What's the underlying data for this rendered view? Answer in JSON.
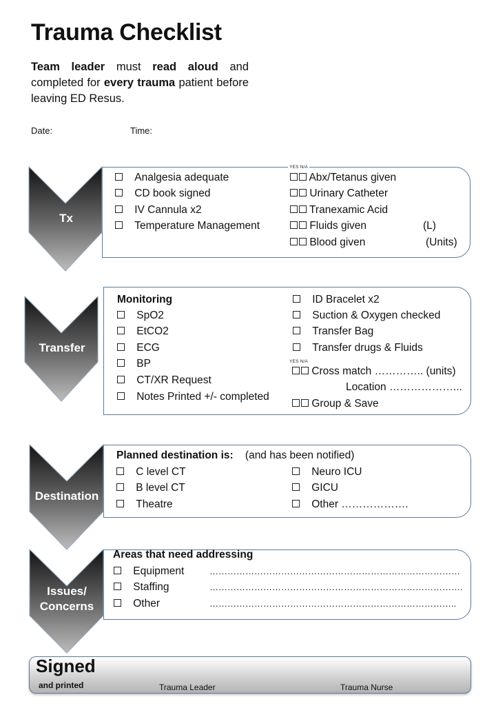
{
  "header": {
    "title": "Trauma Checklist",
    "intro": {
      "p1_bold": "Team leader",
      "p2": " must ",
      "p3_bold": "read aloud",
      "p4": " and completed for ",
      "p5_bold": "every trauma",
      "p6": " patient before leaving ED Resus."
    },
    "date_label": "Date:",
    "time_label": "Time:"
  },
  "sections": {
    "tx": {
      "label": "Tx",
      "yes_label": "YES",
      "na_label": "N/A",
      "left_items": [
        "Analgesia adequate",
        "CD book signed",
        "IV Cannula x2",
        "Temperature Management"
      ],
      "right_items": [
        {
          "label": "Abx/Tetanus given",
          "suffix": ""
        },
        {
          "label": "Urinary Catheter",
          "suffix": ""
        },
        {
          "label": "Tranexamic Acid",
          "suffix": ""
        },
        {
          "label": "Fluids given",
          "suffix": "(L)"
        },
        {
          "label": "Blood given",
          "suffix": "(Units)"
        }
      ]
    },
    "transfer": {
      "label": "Transfer",
      "monitoring_heading": "Monitoring",
      "left_items": [
        "SpO2",
        "EtCO2",
        "ECG",
        "BP",
        "CT/XR Request",
        "Notes Printed +/- completed"
      ],
      "right_items": [
        "ID Bracelet x2",
        "Suction & Oxygen checked",
        "Transfer Bag",
        "Transfer drugs & Fluids"
      ],
      "yes_label": "YES",
      "na_label": "N/A",
      "crossmatch": "Cross match ………….. (units)",
      "location": "Location ………………...",
      "group_save": "Group & Save"
    },
    "destination": {
      "label": "Destination",
      "heading": "Planned destination is:",
      "heading_note": "(and has been notified)",
      "left_items": [
        "C level CT",
        "B level CT",
        "Theatre"
      ],
      "right_items": [
        "Neuro ICU",
        "GICU",
        "Other ………………."
      ]
    },
    "issues": {
      "label_line1": "Issues/",
      "label_line2": "Concerns",
      "heading": "Areas that need addressing",
      "items": [
        {
          "label": "Equipment",
          "blank": "…………………………………………………………………………"
        },
        {
          "label": "Staffing",
          "blank": "…………………………………………………………………………."
        },
        {
          "label": "Other",
          "blank": "……………………………………………………………………….."
        }
      ]
    }
  },
  "signed": {
    "title": "Signed",
    "subtitle": "and printed",
    "leader_label": "Trauma Leader",
    "nurse_label": "Trauma Nurse"
  },
  "colors": {
    "chevron_top": "#1a1a1a",
    "chevron_bottom": "#b5b5b5",
    "box_border": "#5a7a98"
  }
}
